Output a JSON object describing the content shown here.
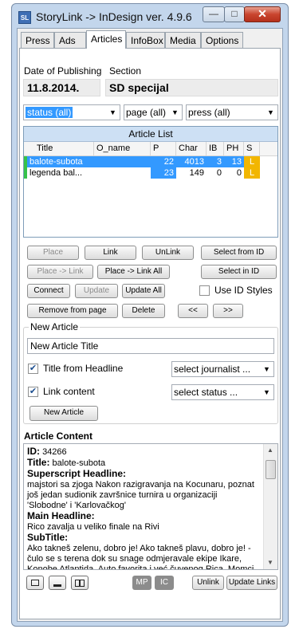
{
  "window": {
    "title": "StoryLink -> InDesign ver. 4.9.6",
    "app_icon_text": "SL",
    "minimize_glyph": "—",
    "maximize_glyph": "□",
    "close_glyph": "✕"
  },
  "tabs": [
    "Press",
    "Ads",
    "Articles",
    "InfoBox",
    "Media",
    "Options"
  ],
  "active_tab": "Articles",
  "publishing": {
    "date_label": "Date of Publishing",
    "date_value": "11.8.2014.",
    "section_label": "Section",
    "section_value": "SD specijal"
  },
  "filters": {
    "status": "status (all)",
    "page": "page (all)",
    "press": "press (all)"
  },
  "article_list": {
    "title": "Article List",
    "columns": [
      "Title",
      "O_name",
      "P",
      "Char",
      "IB",
      "PH",
      "S"
    ],
    "rows": [
      {
        "title": "balote-subota",
        "o_name": "",
        "p": "22",
        "char": "4013",
        "ib": "3",
        "ph": "13",
        "s": "L",
        "selected": true
      },
      {
        "title": "legenda bal...",
        "o_name": "",
        "p": "23",
        "char": "149",
        "ib": "0",
        "ph": "0",
        "s": "L",
        "selected": false
      }
    ]
  },
  "buttons": {
    "place": "Place",
    "link": "Link",
    "unlink": "UnLink",
    "select_from_id": "Select from ID",
    "place_link": "Place -> Link",
    "place_link_all": "Place -> Link All",
    "select_in_id": "Select in ID",
    "connect": "Connect",
    "update": "Update",
    "update_all": "Update All",
    "use_id_styles": "Use ID Styles",
    "remove_from_page": "Remove from page",
    "delete": "Delete",
    "prev": "<<",
    "next": ">>"
  },
  "new_article": {
    "group_title": "New Article",
    "title_value": "New Article Title",
    "title_from_headline": "Title from Headline",
    "title_from_headline_checked": true,
    "journalist": "select journalist ...",
    "link_content": "Link content",
    "link_content_checked": true,
    "status": "select status ...",
    "button": "New Article"
  },
  "content": {
    "title": "Article Content",
    "id_label": "ID:",
    "id_value": "34266",
    "title_label": "Title:",
    "title_value": "balote-subota",
    "superscript_label": "Superscript  Headline:",
    "superscript_text": "majstori sa zjoga Nakon razigravanja na Kocunaru, poznat još jedan sudionik završnice turnira u organizaciji 'Slobodne' i 'Karlovačkog'",
    "main_label": "Main Headline:",
    "main_text": "Rico zavalja u veliko finale na Rivi",
    "subtitle_label": "SubTitle:",
    "subtitle_text": "Ako takneš zelenu, dobro je! Ako takneš plavu, dobro je! - čulo se s terena dok su snage odmjeravale ekipe Ikare, Konobe Atlantida, Auto favorita i već čuvenog Rica. Momci svi u najboljim godinama, s tenisicama na nogama i krpom u ruci - ne za prašinu nego za balote jer ruka se znoji od bacanja i žestine"
  },
  "bottom": {
    "mp": "MP",
    "ic": "IC",
    "unlink": "Unlink",
    "update_links": "Update Links"
  },
  "colors": {
    "selection": "#3399ff",
    "status_locked": "#f2b600",
    "row_marker": "#36c24a"
  }
}
